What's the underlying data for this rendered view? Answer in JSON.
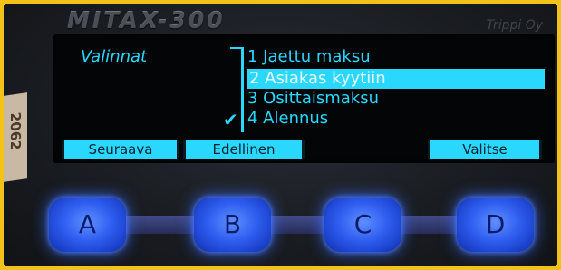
{
  "device": {
    "brand": "MITAX-300",
    "maker": "Trippi Oy",
    "sticker": "2062"
  },
  "screen": {
    "title": "Valinnat",
    "options": [
      "1  Jaettu maksu",
      "2  Asiakas kyytiin",
      "3  Osittaismaksu",
      "4  Alennus"
    ],
    "selected_index": 1,
    "checked_index": 3,
    "check_mark": "✔",
    "softkeys": [
      "Seuraava",
      "Edellinen",
      "Valitse"
    ]
  },
  "buttons": [
    "A",
    "B",
    "C",
    "D"
  ],
  "colors": {
    "display_text": "#2ad8ff",
    "button_glow": "#3b6cff",
    "frame": "#f2c21a"
  }
}
